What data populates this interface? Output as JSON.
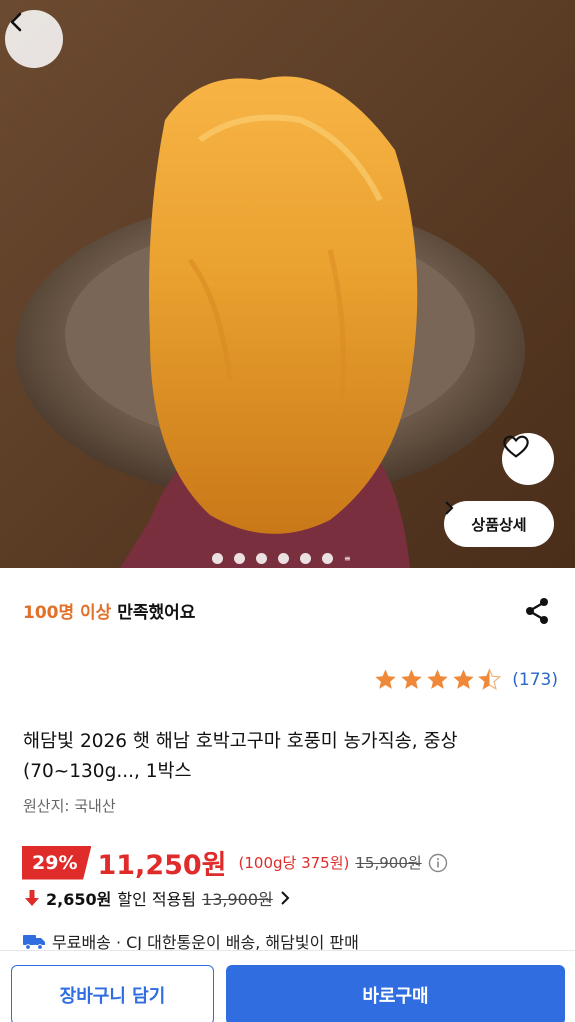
{
  "product_image": {
    "subject": "sweet-potato"
  },
  "hero": {
    "detail_button_label": "상품상세",
    "carousel": {
      "total_dots": 6,
      "active_index": 0
    }
  },
  "satisfaction": {
    "accent": "100명 이상",
    "rest": " 만족했어요"
  },
  "rating": {
    "stars": 4.5,
    "count": "(173)"
  },
  "product": {
    "title": "해담빛 2026 햇 해남 호박고구마 호풍미 농가직송, 중상 (70~130g..., 1박스",
    "origin": "원산지: 국내산"
  },
  "price": {
    "discount": "29%",
    "sale_price": "11,250원",
    "unit_price": "(100g당 375원)",
    "original_price": "15,900원"
  },
  "coupon": {
    "amount": "2,650원",
    "applied_text": "할인 적용됨",
    "struck_price": "13,900원"
  },
  "shipping": {
    "text": "무료배송 · CJ 대한통운이 배송, 해담빛이 판매"
  },
  "bottom_bar": {
    "cart_label": "장바구니 담기",
    "buy_label": "바로구매"
  },
  "colors": {
    "accent_orange": "#e0712a",
    "price_red": "#e02b2b",
    "primary_blue": "#2f6de0",
    "star": "#f0883a"
  }
}
